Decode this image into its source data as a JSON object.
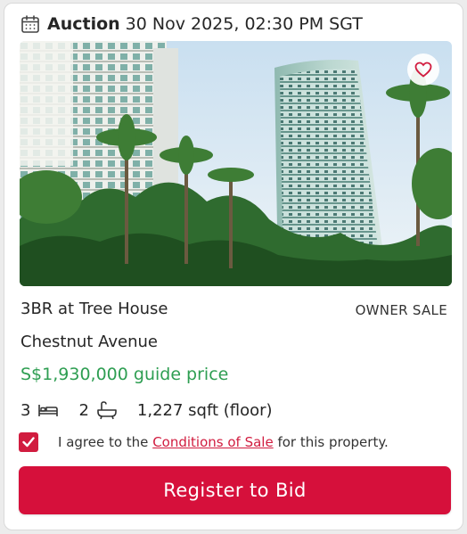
{
  "header": {
    "icon": "calendar-icon",
    "auction_label": "Auction",
    "auction_datetime": "30 Nov 2025, 02:30 PM SGT"
  },
  "listing": {
    "photo_icon": "property-photo",
    "favorite_icon": "heart-icon",
    "title": "3BR at Tree House",
    "sale_type": "OWNER SALE",
    "street": "Chestnut Avenue",
    "price": "S$1,930,000 guide price",
    "bedrooms": "3",
    "bedroom_icon": "bed-icon",
    "bathrooms": "2",
    "bathroom_icon": "bathtub-icon",
    "floor_area": "1,227 sqft (floor)"
  },
  "agreement": {
    "checked": true,
    "text_before": "I agree to the ",
    "link_text": "Conditions of Sale",
    "text_after": " for this property."
  },
  "cta": {
    "label": "Register to Bid"
  },
  "colors": {
    "accent": "#d6103b",
    "price": "#2e9e52"
  }
}
